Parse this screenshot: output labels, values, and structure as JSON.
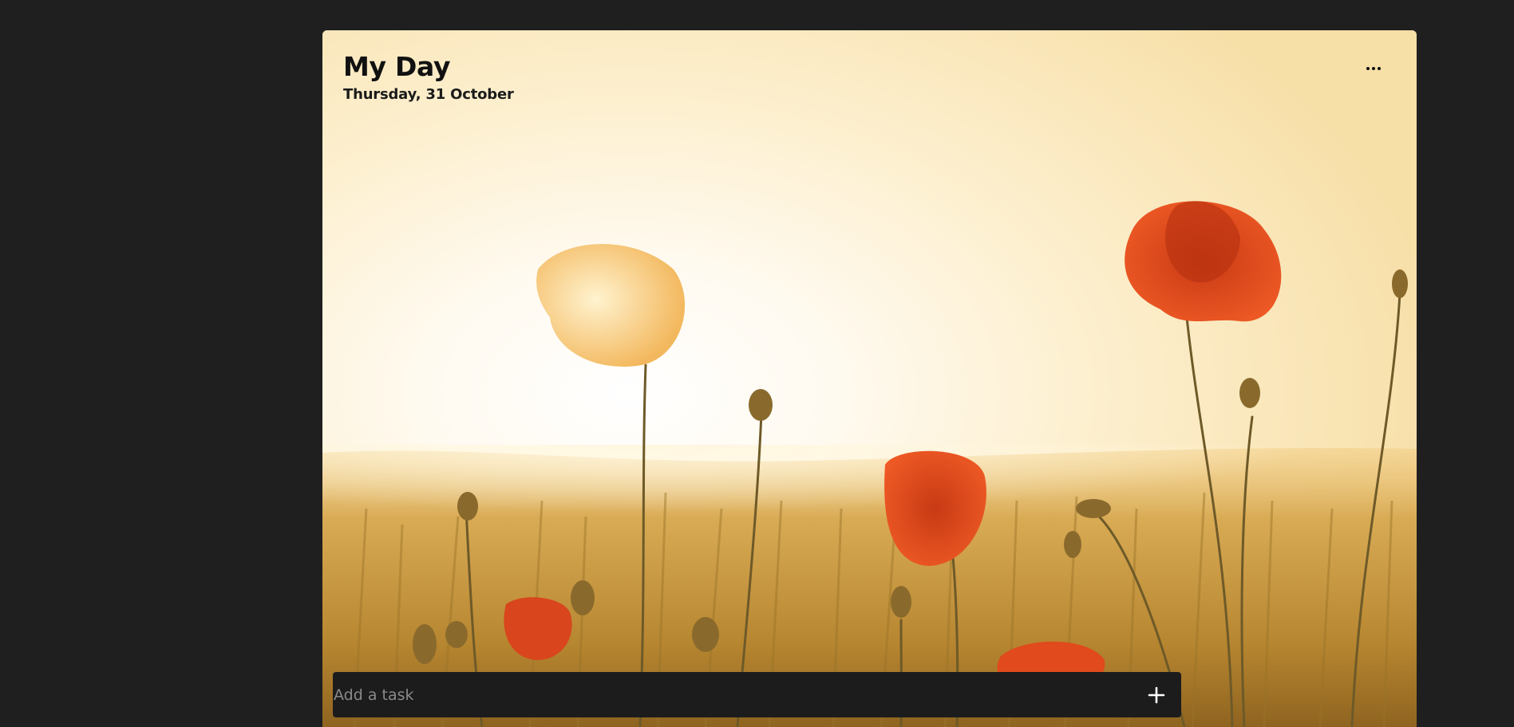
{
  "header": {
    "title": "My Day",
    "date": "Thursday, 31 October"
  },
  "toolbar": {
    "more_icon": "more-horizontal-icon"
  },
  "add_task": {
    "placeholder": "Add a task",
    "add_icon": "plus-icon"
  },
  "background": {
    "scene": "poppy-field-sunset",
    "colors": {
      "sky": "#fff6dd",
      "field": "#c9a04a",
      "poppy": "#e0441c",
      "app_bg": "#1f1f1f",
      "input_bg": "#1c1c1c"
    }
  }
}
